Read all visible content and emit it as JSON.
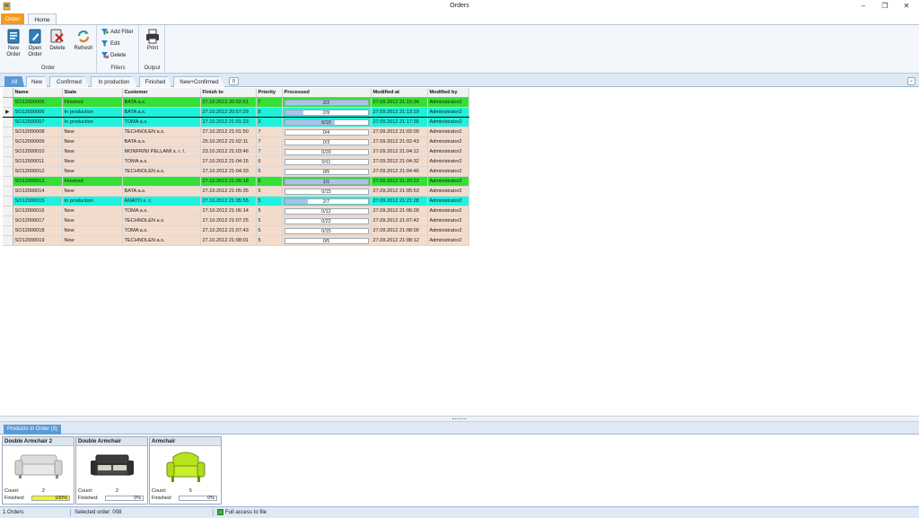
{
  "window": {
    "title": "Orders",
    "controls": {
      "minimize": "–",
      "maximize": "❐",
      "close": "✕"
    }
  },
  "ribbon_tabs": [
    {
      "label": "Order",
      "icon": "",
      "active": false
    },
    {
      "label": "Home",
      "active": true
    }
  ],
  "ribbon": {
    "groups": [
      {
        "label": "Order",
        "buttons": [
          {
            "label_1": "New",
            "label_2": "Order",
            "icon": "new-order-icon"
          },
          {
            "label_1": "Open",
            "label_2": "Order",
            "icon": "open-order-icon"
          },
          {
            "label_1": "Delete",
            "label_2": "",
            "icon": "delete-icon"
          },
          {
            "label_1": "Refresh",
            "label_2": "",
            "icon": "refresh-icon"
          }
        ]
      },
      {
        "label": "Filters",
        "buttons": [
          {
            "label": "Add Filter",
            "icon": "add-filter-icon"
          },
          {
            "label": "Edit",
            "icon": "edit-filter-icon"
          },
          {
            "label": "Delete",
            "icon": "delete-filter-icon"
          }
        ]
      },
      {
        "label": "Output",
        "buttons": [
          {
            "label": "Print",
            "icon": "print-icon"
          }
        ]
      }
    ]
  },
  "filter_tabs": [
    "All",
    "New",
    "Confirmed",
    "In production",
    "Finished",
    "New+Confirmed"
  ],
  "filter_tab_count": "0",
  "orders": {
    "columns": [
      "Name",
      "State",
      "Customer",
      "Finish to",
      "Priority",
      "Processed",
      "Modified at",
      "Modified by"
    ],
    "rows": [
      {
        "name": "SO12000005",
        "state": "Finished",
        "customer": "BATA a.s.",
        "finish_to": "27.10.2012 20:52:51",
        "priority": "7",
        "processed": "2/2",
        "fraction": 1.0,
        "modified_at": "27.09.2012 21:15:34",
        "modified_by": "Administrator2",
        "style": "finished",
        "selected": false
      },
      {
        "name": "SO12000006",
        "state": "In production",
        "customer": "BATA a.s.",
        "finish_to": "27.10.2012 20:57:29",
        "priority": "8",
        "processed": "2/9",
        "fraction": 0.22,
        "modified_at": "27.09.2012 21:13:19",
        "modified_by": "Administrator2",
        "style": "inproduction",
        "selected": true
      },
      {
        "name": "SO12000007",
        "state": "In production",
        "customer": "TOMA a.s.",
        "finish_to": "27.10.2012 21:01:23",
        "priority": "3",
        "processed": "6/10",
        "fraction": 0.6,
        "modified_at": "27.09.2012 21:17:35",
        "modified_by": "Administrator2",
        "style": "inproduction",
        "selected": false
      },
      {
        "name": "SO12000008",
        "state": "New",
        "customer": "TECHNOLEN a.s.",
        "finish_to": "27.10.2012 21:01:50",
        "priority": "7",
        "processed": "0/4",
        "fraction": 0,
        "modified_at": "27.09.2012 21:02:09",
        "modified_by": "Administrator2",
        "style": "new",
        "selected": false
      },
      {
        "name": "SO12000009",
        "state": "New",
        "customer": "BATA a.s.",
        "finish_to": "25.10.2012 21:02:11",
        "priority": "7",
        "processed": "0/3",
        "fraction": 0,
        "modified_at": "27.09.2012 21:02:43",
        "modified_by": "Administrator2",
        "style": "new",
        "selected": false
      },
      {
        "name": "SO12000010",
        "state": "New",
        "customer": "MONFRINI PELLAMI s. r. l.",
        "finish_to": "23.10.2012 21:03:46",
        "priority": "7",
        "processed": "0/20",
        "fraction": 0,
        "modified_at": "27.09.2012 21:04:12",
        "modified_by": "Administrator2",
        "style": "new",
        "selected": false
      },
      {
        "name": "SO12000011",
        "state": "New",
        "customer": "TOMA a.s.",
        "finish_to": "27.10.2012 21:04:15",
        "priority": "6",
        "processed": "0/11",
        "fraction": 0,
        "modified_at": "27.09.2012 21:04:32",
        "modified_by": "Administrator2",
        "style": "new",
        "selected": false
      },
      {
        "name": "SO12000012",
        "state": "New",
        "customer": "TECHNOLEN a.s.",
        "finish_to": "27.10.2012 21:04:33",
        "priority": "5",
        "processed": "0/5",
        "fraction": 0,
        "modified_at": "27.09.2012 21:04:46",
        "modified_by": "Administrator2",
        "style": "new",
        "selected": false
      },
      {
        "name": "SO12000013",
        "state": "Finished",
        "customer": "",
        "finish_to": "27.10.2012 21:05:18",
        "priority": "5",
        "processed": "1/1",
        "fraction": 1.0,
        "modified_at": "27.09.2012 21:20:22",
        "modified_by": "Administrator2",
        "style": "finished",
        "selected": false
      },
      {
        "name": "SO12000014",
        "state": "New",
        "customer": "BATA a.s.",
        "finish_to": "27.10.2012 21:05:35",
        "priority": "5",
        "processed": "0/15",
        "fraction": 0,
        "modified_at": "27.09.2012 21:05:53",
        "modified_by": "Administrator2",
        "style": "new",
        "selected": false
      },
      {
        "name": "SO12000015",
        "state": "In production",
        "customer": "AMATO s. c.",
        "finish_to": "27.10.2012 21:05:55",
        "priority": "5",
        "processed": "2/7",
        "fraction": 0.28,
        "modified_at": "27.09.2012 21:21:28",
        "modified_by": "Administrator2",
        "style": "inproduction",
        "selected": false
      },
      {
        "name": "SO12000016",
        "state": "New",
        "customer": "TOMA a.s.",
        "finish_to": "27.10.2012 21:06:14",
        "priority": "5",
        "processed": "0/12",
        "fraction": 0,
        "modified_at": "27.09.2012 21:06:28",
        "modified_by": "Administrator2",
        "style": "new",
        "selected": false
      },
      {
        "name": "SO12000017",
        "state": "New",
        "customer": "TECHNOLEN a.s.",
        "finish_to": "27.10.2012 21:07:25",
        "priority": "5",
        "processed": "0/22",
        "fraction": 0,
        "modified_at": "27.09.2012 21:07:42",
        "modified_by": "Administrator2",
        "style": "new",
        "selected": false
      },
      {
        "name": "SO12000018",
        "state": "New",
        "customer": "TOMA a.s.",
        "finish_to": "27.10.2012 21:07:43",
        "priority": "5",
        "processed": "0/15",
        "fraction": 0,
        "modified_at": "27.09.2012 21:08:00",
        "modified_by": "Administrator2",
        "style": "new",
        "selected": false
      },
      {
        "name": "SO12000019",
        "state": "New",
        "customer": "TECHNOLEN a.s.",
        "finish_to": "27.10.2012 21:08:01",
        "priority": "5",
        "processed": "0/5",
        "fraction": 0,
        "modified_at": "27.09.2012 21:08:12",
        "modified_by": "Administrator2",
        "style": "new",
        "selected": false
      }
    ],
    "row_colors": {
      "new": "#f4dccd",
      "finished": "#33e033",
      "inproduction": "#1ef2dc",
      "progress_fill": "#a7c4ea"
    }
  },
  "products_panel": {
    "tab_label": "Products in Order (3)",
    "count_label": "Count:",
    "finished_label": "Finished:",
    "products": [
      {
        "name": "Double Armchair 2",
        "count": "2",
        "finished": "100%",
        "finished_fraction": 1.0,
        "image": "white-sofa-image"
      },
      {
        "name": "Double Armchair",
        "count": "2",
        "finished": "0%",
        "finished_fraction": 0,
        "image": "dark-sofa-image"
      },
      {
        "name": "Armchair",
        "count": "5",
        "finished": "0%",
        "finished_fraction": 0,
        "image": "green-armchair-image"
      }
    ]
  },
  "status_bar": {
    "orders": "1 Orders",
    "selected_order": "Selected order: 008",
    "access": "Full access to file"
  }
}
